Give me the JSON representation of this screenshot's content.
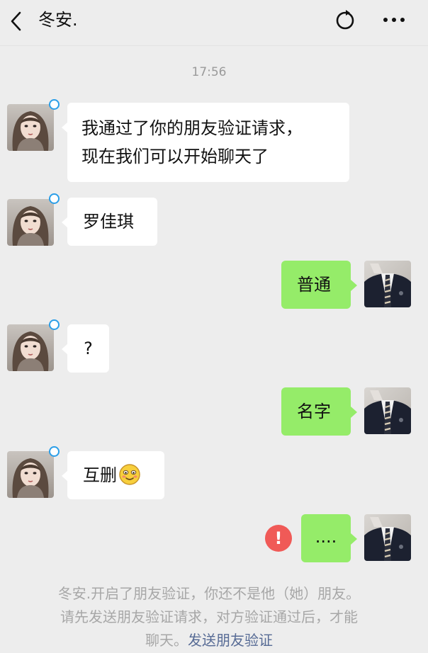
{
  "header": {
    "title": "冬安.",
    "back_icon": "chevron-left-icon",
    "refresh_icon": "refresh-circle-icon",
    "more_icon": "more-dots-icon"
  },
  "chat": {
    "timestamp": "17:56",
    "messages": [
      {
        "sender": "contact",
        "lines": [
          "我通过了你的朋友验证请求，",
          "现在我们可以开始聊天了"
        ]
      },
      {
        "sender": "contact",
        "text": "罗佳琪"
      },
      {
        "sender": "me",
        "text": "普通"
      },
      {
        "sender": "contact",
        "text": "?"
      },
      {
        "sender": "me",
        "text": "名字"
      },
      {
        "sender": "contact",
        "text": "互删",
        "emoji": "smile-emoji-icon"
      },
      {
        "sender": "me",
        "text": "....",
        "status": "send-failed",
        "status_icon": "!"
      }
    ]
  },
  "system_notice": {
    "line1": "冬安.开启了朋友验证，你还不是他（她）朋友。",
    "line2": "请先发送朋友验证请求，对方验证通过后，才能",
    "line3": "聊天。",
    "link": "发送朋友验证"
  },
  "colors": {
    "background": "#ededed",
    "bubble_sent": "#95ec69",
    "bubble_received": "#ffffff",
    "error": "#f05a57",
    "link": "#576b95"
  }
}
